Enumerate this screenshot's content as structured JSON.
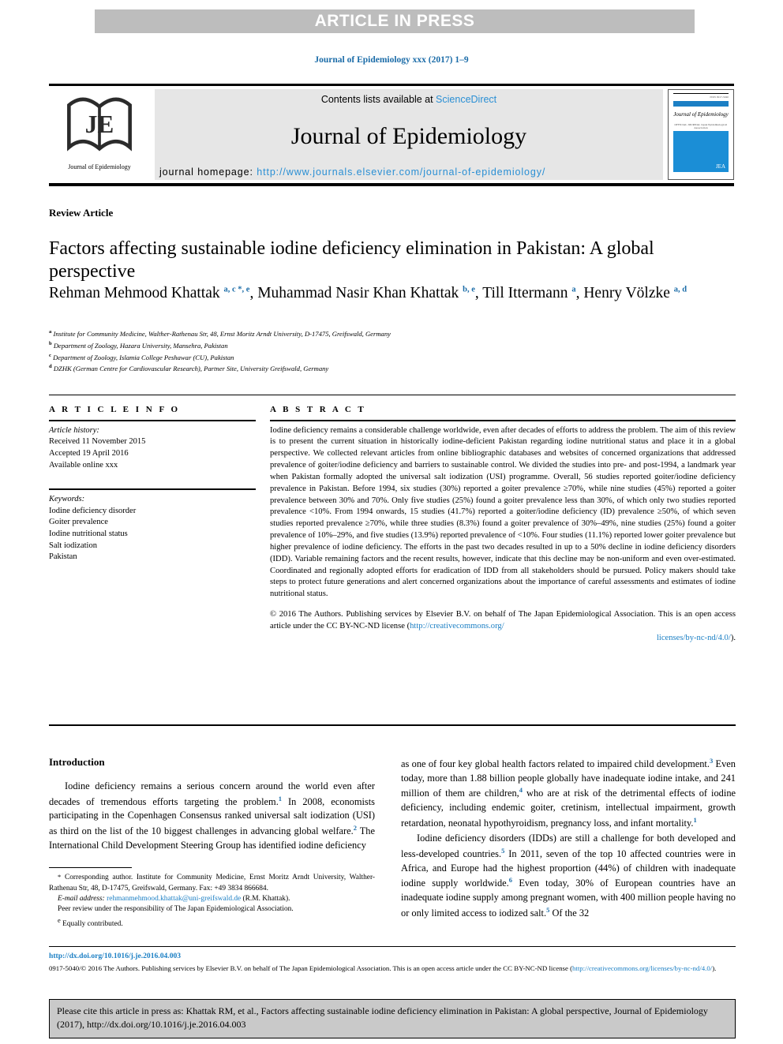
{
  "banner": {
    "text": "ARTICLE IN PRESS"
  },
  "journal_ref": "Journal of Epidemiology xxx (2017) 1–9",
  "masthead": {
    "contents_prefix": "Contents lists available at ",
    "sciencedirect": "ScienceDirect",
    "journal_title": "Journal of Epidemiology",
    "homepage_label": "journal homepage: ",
    "homepage_url": "http://www.journals.elsevier.com/journal-of-epidemiology/",
    "logo_mark": "JE",
    "logo_caption": "Journal of Epidemiology",
    "cover": {
      "issn": "ISSN 0917-5040",
      "name": "Journal of Epidemiology",
      "strip": "OFFICIAL JOURNAL  Japan Epidemiological Association",
      "mark": "JEA"
    }
  },
  "article": {
    "type_label": "Review Article",
    "title": "Factors affecting sustainable iodine deficiency elimination in Pakistan: A global perspective",
    "authors_html": "Rehman Mehmood Khattak <sup>a, c *, e</sup>, Muhammad Nasir Khan Khattak <sup>b, e</sup>, Till Ittermann <sup>a</sup>, Henry Völzke <sup>a, d</sup>",
    "affiliations": [
      {
        "mark": "a",
        "text": "Institute for Community Medicine, Walther-Rathenau Str, 48, Ernst Moritz Arndt University, D-17475, Greifswald, Germany"
      },
      {
        "mark": "b",
        "text": "Department of Zoology, Hazara University, Mansehra, Pakistan"
      },
      {
        "mark": "c",
        "text": "Department of Zoology, Islamia College Peshawar (CU), Pakistan"
      },
      {
        "mark": "d",
        "text": "DZHK (German Centre for Cardiovascular Research), Partner Site, University Greifswald, Germany"
      }
    ]
  },
  "article_info": {
    "heading": "A R T I C L E  I N F O",
    "history_label": "Article history:",
    "history": [
      "Received 11 November 2015",
      "Accepted 19 April 2016",
      "Available online xxx"
    ],
    "keywords_label": "Keywords:",
    "keywords": [
      "Iodine deficiency disorder",
      "Goiter prevalence",
      "Iodine nutritional status",
      "Salt iodization",
      "Pakistan"
    ]
  },
  "abstract": {
    "heading": "A B S T R A C T",
    "body": "Iodine deficiency remains a considerable challenge worldwide, even after decades of efforts to address the problem. The aim of this review is to present the current situation in historically iodine-deficient Pakistan regarding iodine nutritional status and place it in a global perspective. We collected relevant articles from online bibliographic databases and websites of concerned organizations that addressed prevalence of goiter/iodine deficiency and barriers to sustainable control. We divided the studies into pre- and post-1994, a landmark year when Pakistan formally adopted the universal salt iodization (USI) programme. Overall, 56 studies reported goiter/iodine deficiency prevalence in Pakistan. Before 1994, six studies (30%) reported a goiter prevalence ≥70%, while nine studies (45%) reported a goiter prevalence between 30% and 70%. Only five studies (25%) found a goiter prevalence less than 30%, of which only two studies reported prevalence <10%. From 1994 onwards, 15 studies (41.7%) reported a goiter/iodine deficiency (ID) prevalence ≥50%, of which seven studies reported prevalence ≥70%, while three studies (8.3%) found a goiter prevalence of 30%–49%, nine studies (25%) found a goiter prevalence of 10%–29%, and five studies (13.9%) reported prevalence of <10%. Four studies (11.1%) reported lower goiter prevalence but higher prevalence of iodine deficiency. The efforts in the past two decades resulted in up to a 50% decline in iodine deficiency disorders (IDD). Variable remaining factors and the recent results, however, indicate that this decline may be non-uniform and even over-estimated. Coordinated and regionally adopted efforts for eradication of IDD from all stakeholders should be pursued. Policy makers should take steps to protect future generations and alert concerned organizations about the importance of careful assessments and estimates of iodine nutritional status.",
    "copyright_text": "© 2016 The Authors. Publishing services by Elsevier B.V. on behalf of The Japan Epidemiological Association. This is an open access article under the CC BY-NC-ND license (",
    "license_url_1": "http://creativecommons.org/",
    "license_url_2": "licenses/by-nc-nd/4.0/",
    "copyright_tail": ")."
  },
  "introduction": {
    "heading": "Introduction",
    "left_para_1": "Iodine deficiency remains a serious concern around the world even after decades of tremendous efforts targeting the problem.<sup>1</sup> In 2008, economists participating in the Copenhagen Consensus ranked universal salt iodization (USI) as third on the list of the 10 biggest challenges in advancing global welfare.<sup>2</sup> The International Child Development Steering Group has identified iodine deficiency",
    "right_para_1": "as one of four key global health factors related to impaired child development.<sup>3</sup> Even today, more than 1.88 billion people globally have inadequate iodine intake, and 241 million of them are children,<sup>4</sup> who are at risk of the detrimental effects of iodine deficiency, including endemic goiter, cretinism, intellectual impairment, growth retardation, neonatal hypothyroidism, pregnancy loss, and infant mortality.<sup>1</sup>",
    "right_para_2": "Iodine deficiency disorders (IDDs) are still a challenge for both developed and less-developed countries.<sup>5</sup> In 2011, seven of the top 10 affected countries were in Africa, and Europe had the highest proportion (44%) of children with inadequate iodine supply worldwide.<sup>6</sup> Even today, 30% of European countries have an inadequate iodine supply among pregnant women, with 400 million people having no or only limited access to iodized salt.<sup>5</sup> Of the 32"
  },
  "footnotes": {
    "corresponding": "Corresponding author. Institute for Community Medicine, Ernst Moritz Arndt University, Walther-Rathenau Str, 48, D-17475, Greifswald, Germany. Fax: +49 3834 866684.",
    "email_label": "E-mail address:",
    "email": "rehmanmehmood.khattak@uni-greifswald.de",
    "email_suffix": "(R.M. Khattak).",
    "peer_review": "Peer review under the responsibility of The Japan Epidemiological Association.",
    "equal_mark": "e",
    "equal_text": "Equally contributed."
  },
  "bottom": {
    "doi": "http://dx.doi.org/10.1016/j.je.2016.04.003",
    "issn_text_1": "0917-5040/© 2016 The Authors. Publishing services by Elsevier B.V. on behalf of The Japan Epidemiological Association. This is an open access article under the CC BY-NC-ND license (",
    "issn_link": "http://creativecommons.org/licenses/by-nc-nd/4.0/",
    "issn_text_2": ").",
    "citation": "Please cite this article in press as: Khattak RM, et al., Factors affecting sustainable iodine deficiency elimination in Pakistan: A global perspective, Journal of Epidemiology (2017), http://dx.doi.org/10.1016/j.je.2016.04.003"
  },
  "colors": {
    "link_blue": "#1b7fc4",
    "ref_blue": "#1b6ca8",
    "banner_gray": "#bdbdbd",
    "masthead_gray": "#e6e6e6",
    "cite_gray": "#c9c9c9",
    "cover_blue": "#1b8ed6"
  }
}
